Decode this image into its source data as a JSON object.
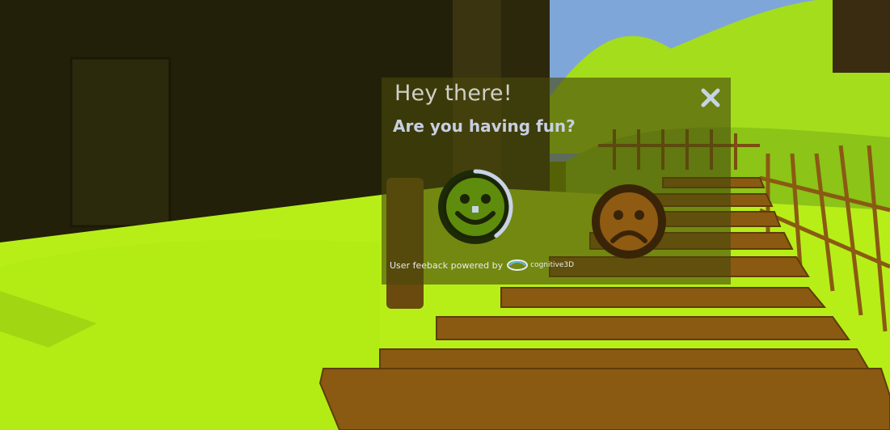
{
  "survey": {
    "title": "Hey there!",
    "question": "Are you having fun?",
    "credit": "User feeback powered by",
    "brand": "cognitive3D"
  },
  "answers": [
    {
      "name": "happy-face",
      "mood": "positive",
      "selected_progress": 0.4
    },
    {
      "name": "sad-face",
      "mood": "negative"
    }
  ],
  "colors": {
    "ground": "#b7ee18",
    "wood": "#8a5a12",
    "panel": "#48480c",
    "happy": "#5e8c0c",
    "sad": "#8f5a12",
    "progress_ring": "#c7d3e6"
  },
  "icons": [
    "close-icon",
    "happy-face-icon",
    "sad-face-icon",
    "cognitive3d-logo-icon"
  ]
}
